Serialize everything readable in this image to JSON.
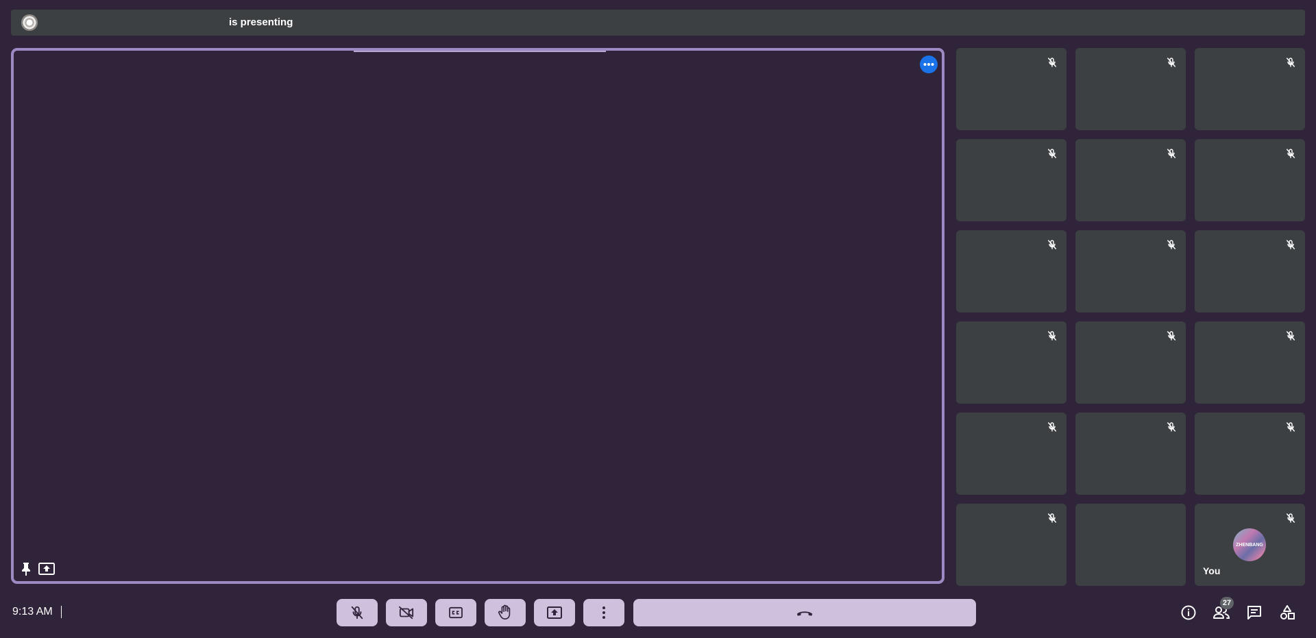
{
  "banner": {
    "presenter_status": "is presenting",
    "avatar_icon": "presenter-avatar"
  },
  "stage": {
    "more_icon": "more-horizontal-icon",
    "pin_icon": "pin-icon",
    "present_icon": "present-to-all-icon"
  },
  "participants": {
    "tiles_muted_count": 17,
    "self": {
      "label": "You",
      "avatar_text": "ZHENBANG"
    }
  },
  "bottom_bar": {
    "time": "9:13 AM",
    "controls": [
      {
        "name": "mic-button",
        "icon": "mic-off-icon"
      },
      {
        "name": "camera-button",
        "icon": "videocam-off-icon"
      },
      {
        "name": "captions-button",
        "icon": "closed-caption-icon"
      },
      {
        "name": "raise-hand-button",
        "icon": "hand-icon"
      },
      {
        "name": "present-button",
        "icon": "present-to-all-icon"
      },
      {
        "name": "more-options-button",
        "icon": "more-vertical-icon"
      }
    ],
    "hangup_icon": "call-end-icon",
    "right": {
      "info_icon": "info-icon",
      "people_icon": "people-icon",
      "people_count": "27",
      "chat_icon": "chat-icon",
      "activities_icon": "activities-icon"
    }
  },
  "colors": {
    "background": "#30243a",
    "tile": "#3c4043",
    "control": "#cfc0de",
    "stage_border": "#9e8ac2",
    "accent_blue": "#1a73e8"
  }
}
